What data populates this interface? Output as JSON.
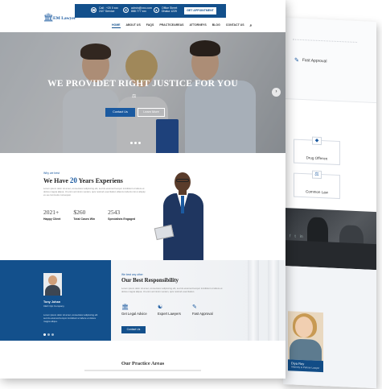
{
  "header": {
    "logo_text": "EM Lawyer",
    "contact": [
      {
        "icon": "phone-icon",
        "line1": "Call : +20 0 xxx",
        "line2": "24/7 Service"
      },
      {
        "icon": "mail-icon",
        "line1": "admin@xxx.com",
        "line2": "888 777 xxx"
      },
      {
        "icon": "location-icon",
        "line1": "Office Street",
        "line2": "Dhaka 1229"
      }
    ],
    "appointment_button": "GET APPOINTMENT",
    "nav": [
      "HOME",
      "ABOUT US",
      "FAQS",
      "PRACTICEAREAS",
      "ATTORNEYS",
      "BLOG",
      "CONTACT US"
    ]
  },
  "hero": {
    "title": "WE PROVIDET RIGHT JUSTICE FOR YOU",
    "button_primary": "Contact Us",
    "button_secondary": "Learn More"
  },
  "about": {
    "label": "Why we best",
    "heading_pre": "We Have ",
    "heading_num": "20",
    "heading_post": " Years Experiens",
    "text": "Lorem ipsum dolor sit amet, consectetur adipiscing elit, sed do eiusmod tempor incididunt ut labore et dolore magna aliqua. Ut enim ad minim veniam, quis nostrud exercitation ullamco laboris nisi ut aliquip ex ea commodo consequat.",
    "stats": [
      {
        "value": "2021+",
        "label": "Happy Client"
      },
      {
        "value": "$260",
        "label": "Total Cases Win"
      },
      {
        "value": "2543",
        "label": "Specialists Engaged"
      }
    ]
  },
  "testimonial": {
    "name": "Tony Johan",
    "role": "CEO Opt Company",
    "text": "Lorem ipsum dolor sit amet, consectetur adipiscing elit sed do eiusmod tempor incididunt ut labore et dolore magna aliqua."
  },
  "responsibility": {
    "label": "We best any other",
    "heading": "Our Best Responsibility",
    "text": "Lorem ipsum dolor sit amet, consectetur adipiscing elit, sed do eiusmod tempor incididunt ut labore et dolore magna aliqua. Ut enim ad minim veniam, quis nostrud exercitation.",
    "features": [
      {
        "icon": "bank-icon",
        "label": "Get Legal Advice"
      },
      {
        "icon": "handshake-icon",
        "label": "Expert Lawyers"
      },
      {
        "icon": "checklist-icon",
        "label": "Fast Approval"
      }
    ],
    "button": "Contact Us"
  },
  "practice": {
    "heading": "Our Practice Areas"
  },
  "back_page": {
    "feature_label": "Fast Approval",
    "cards": [
      "Drug Offence",
      "Common Law"
    ],
    "profile_name": "Diya Roy",
    "profile_role": "Attorney & Partner Lawyer"
  }
}
